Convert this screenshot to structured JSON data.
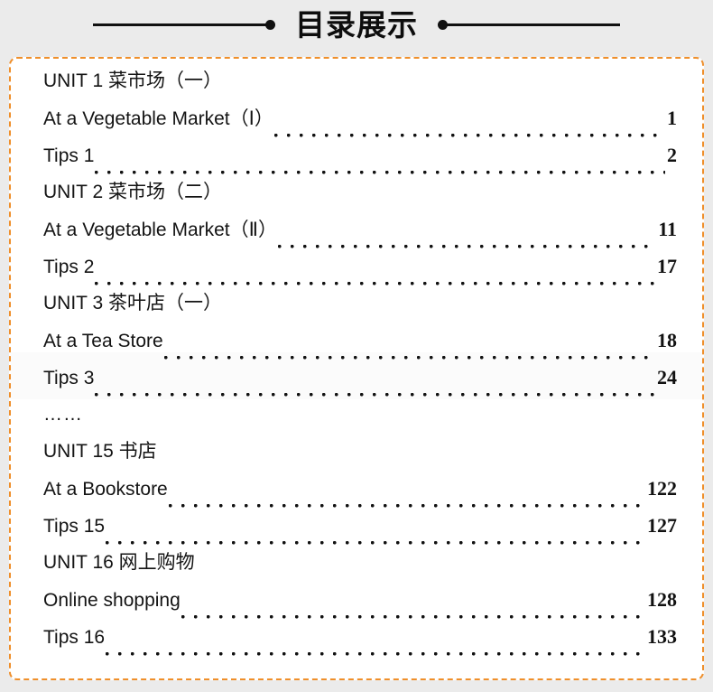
{
  "header": {
    "title": "目录展示",
    "left_rule": "horizontal-rule",
    "right_rule": "horizontal-rule"
  },
  "panel": {
    "border_color": "#ef8f2b",
    "background": "#ffffff",
    "watermark_text": ""
  },
  "toc": {
    "rows": [
      {
        "title": "UNIT 1 菜市场（一）",
        "page": "",
        "type": "heading"
      },
      {
        "title": "At a Vegetable Market（Ⅰ）",
        "page": "1",
        "type": "entry"
      },
      {
        "title": "Tips  1",
        "page": "2",
        "type": "entry"
      },
      {
        "title": "UNIT 2 菜市场（二）",
        "page": "",
        "type": "heading"
      },
      {
        "title": "At a Vegetable Market（Ⅱ）",
        "page": "11",
        "type": "entry"
      },
      {
        "title": "Tips  2",
        "page": "17",
        "type": "entry"
      },
      {
        "title": "UNIT 3 茶叶店（一）",
        "page": "",
        "type": "heading"
      },
      {
        "title": "At a Tea Store",
        "page": "18",
        "type": "entry"
      },
      {
        "title": "Tips  3",
        "page": "24",
        "type": "entry"
      },
      {
        "title": "……",
        "page": "",
        "type": "ellipsis"
      },
      {
        "title": "UNIT 15 书店",
        "page": "",
        "type": "heading"
      },
      {
        "title": "At a Bookstore",
        "page": "122",
        "type": "entry"
      },
      {
        "title": "Tips  15",
        "page": "127",
        "type": "entry"
      },
      {
        "title": "UNIT 16 网上购物",
        "page": "",
        "type": "heading"
      },
      {
        "title": "Online shopping",
        "page": "128",
        "type": "entry"
      },
      {
        "title": "Tips  16",
        "page": "133",
        "type": "entry"
      }
    ]
  }
}
